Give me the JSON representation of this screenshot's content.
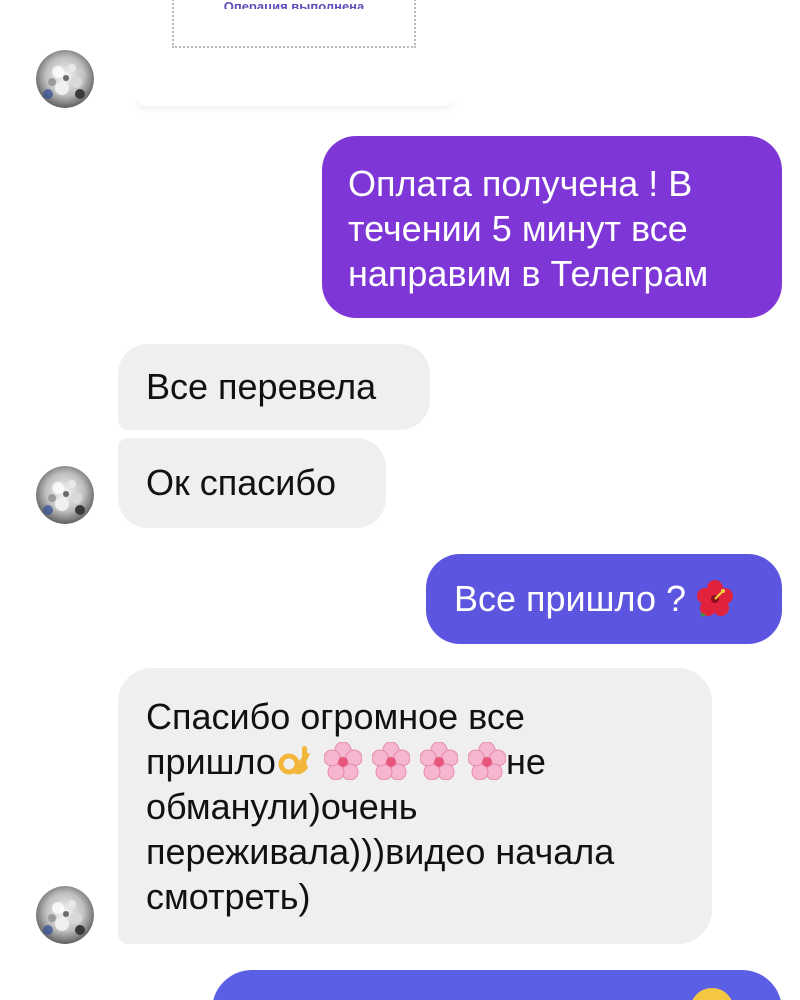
{
  "receipt": {
    "status_text": "Операция выполнена"
  },
  "messages": {
    "out1": [
      "Оплата получена ! В",
      "течении 5 минут все",
      "направим в Телеграм"
    ],
    "in1": "Все перевела",
    "in2": "Ок спасибо",
    "out2": "Все пришло ?",
    "in3_line1": "Спасибо огромное все",
    "in3_line2_start": "пришло",
    "in3_line2_end": "не",
    "in3_rest": [
      "обманули)очень",
      "переживала)))видео начала",
      "смотреть)"
    ]
  },
  "icons": {
    "avatar": "avatar-glitter-icon",
    "hibiscus": "hibiscus-emoji-icon",
    "ok_hand": "ok-hand-emoji-icon",
    "blossom": "cherry-blossom-emoji-icon"
  },
  "colors": {
    "outgoing_purple": "#7b3ad8",
    "outgoing_violet": "#5c55df",
    "incoming_gray": "#efefef",
    "receipt_text": "#5a4fb8"
  }
}
